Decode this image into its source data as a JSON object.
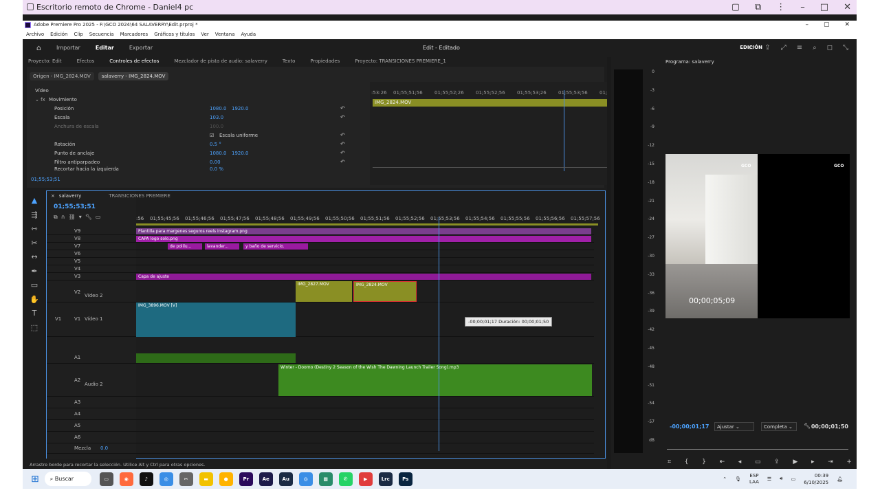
{
  "chrome": {
    "title": "Escritorio remoto de Chrome - Daniel4 pc"
  },
  "app": {
    "title": "Adobe Premiere Pro 2025 - F:\\GCO 2024\\64 SALAVERRY\\Edit.prproj *",
    "menus": [
      "Archivo",
      "Edición",
      "Clip",
      "Secuencia",
      "Marcadores",
      "Gráficos y títulos",
      "Ver",
      "Ventana",
      "Ayuda"
    ],
    "workspace": {
      "tabs": [
        "Importar",
        "Editar",
        "Exportar"
      ],
      "active": "Editar",
      "center": "Edit - Editado",
      "mode": "EDICIÓN"
    }
  },
  "panels": {
    "tabs": [
      "Proyecto: Edit",
      "Efectos",
      "Controles de efectos",
      "Mezclador de pista de audio: salaverry",
      "Texto",
      "Propiedades",
      "Proyecto: TRANSICIONES PREMIERE_1"
    ],
    "active": "Controles de efectos"
  },
  "effect_controls": {
    "source_tab": "Origen - IMG_2824.MOV",
    "seq_tab": "salaverry - IMG_2824.MOV",
    "section": "Vídeo",
    "group": "Movimiento",
    "props": [
      {
        "name": "Posición",
        "v1": "1080.0",
        "v2": "1920.0"
      },
      {
        "name": "Escala",
        "v1": "103.0",
        "v2": ""
      },
      {
        "name": "Anchura de escala",
        "v1": "100.0",
        "v2": ""
      },
      {
        "name": "Escala uniforme",
        "v1": "",
        "v2": ""
      },
      {
        "name": "Rotación",
        "v1": "0.5 °",
        "v2": ""
      },
      {
        "name": "Punto de anclaje",
        "v1": "1080.0",
        "v2": "1920.0"
      },
      {
        "name": "Filtro antiparpadeo",
        "v1": "0.00",
        "v2": ""
      },
      {
        "name": "Recortar hacia la izquierda",
        "v1": "0.0 %",
        "v2": ""
      }
    ],
    "ruler": [
      ":53:26",
      "01;55;51;56",
      "01;55;52;26",
      "01;55;52;56",
      "01;55;53;26",
      "01;55;53;56",
      "01;55;54"
    ],
    "clip": "IMG_2824.MOV",
    "timecode": "01;55;53;51"
  },
  "meter": {
    "labels": [
      "0",
      "-3",
      "-6",
      "-9",
      "-12",
      "-15",
      "-18",
      "-21",
      "-24",
      "-27",
      "-30",
      "-33",
      "-36",
      "-39",
      "-42",
      "-45",
      "-48",
      "-51",
      "-54",
      "-57",
      "dB"
    ]
  },
  "program": {
    "title": "Programa: salaverry",
    "timecode": "-00;00;01;17",
    "fit": "Ajustar",
    "quality": "Completa",
    "duration": "00;00;01;50",
    "frame_tc": "00;00;05;09",
    "logo": "GCO"
  },
  "timeline": {
    "tabs": [
      "salaverry",
      "TRANSICIONES PREMIERE"
    ],
    "timecode": "01;55;53;51",
    "ruler": [
      ":56",
      "01;55;45;56",
      "01;55;46;56",
      "01;55;47;56",
      "01;55;48;56",
      "01;55;49;56",
      "01;55;50;56",
      "01;55;51;56",
      "01;55;52;56",
      "01;55;53;56",
      "01;55;54;56",
      "01;55;55;56",
      "01;55;56;56",
      "01;55;57;56"
    ],
    "video_tracks": [
      {
        "id": "V9",
        "clip": "Plantilla para margenes seguros reels instagram.png"
      },
      {
        "id": "V8",
        "clip": "CAPA logo solo.png"
      },
      {
        "id": "V7",
        "clips": [
          "de polilu...",
          "lavander...",
          "y baño de servicio."
        ]
      },
      {
        "id": "V6"
      },
      {
        "id": "V5"
      },
      {
        "id": "V4"
      },
      {
        "id": "V3",
        "clip": "Capa de ajuste"
      },
      {
        "id": "V2",
        "name": "Vídeo 2",
        "clips": [
          "IMG_2827.MOV",
          "IMG_2824.MOV"
        ]
      },
      {
        "id": "V1",
        "name": "Vídeo 1",
        "clip": "IMG_3896.MOV [V]"
      }
    ],
    "audio_tracks": [
      {
        "id": "A1"
      },
      {
        "id": "A2",
        "name": "Audio 2",
        "clip": "Winter - Doomo (Destiny 2 Season of the Wish The Dawning Launch Trailer Song).mp3"
      },
      {
        "id": "A3"
      },
      {
        "id": "A4"
      },
      {
        "id": "A5"
      },
      {
        "id": "A6"
      }
    ],
    "mix_label": "Mezcla",
    "mix_value": "0.0",
    "tooltip": "-00;00;01;17 Duración: 00;00;01;50"
  },
  "status": "Arrastre borde para recortar la selección. Utilice Alt y Ctrl para otras opciones.",
  "taskbar": {
    "search": "Buscar",
    "lang": "ESP",
    "lang2": "LAA",
    "time": "00:39",
    "date": "6/10/2025",
    "apps": [
      "Pr",
      "Ae",
      "Au",
      "Ps",
      "Lrc"
    ]
  }
}
